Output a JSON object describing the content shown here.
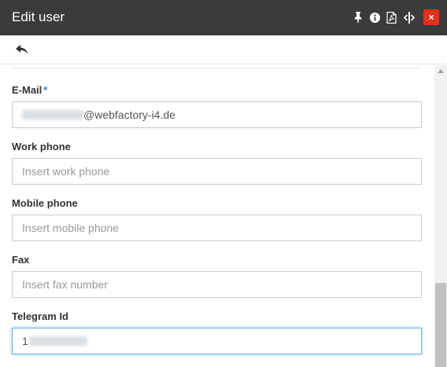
{
  "window": {
    "title": "Edit user",
    "close_label": "×"
  },
  "header_icons": [
    "pin-icon",
    "info-icon",
    "pdf-icon",
    "resize-icon"
  ],
  "toolbar": {
    "back_icon": "reply-arrow-icon"
  },
  "fields": {
    "email": {
      "label": "E-Mail",
      "required_mark": "*",
      "value_suffix": "@webfactory-i4.de"
    },
    "work_phone": {
      "label": "Work phone",
      "placeholder": "Insert work phone"
    },
    "mobile_phone": {
      "label": "Mobile phone",
      "placeholder": "Insert mobile phone"
    },
    "fax": {
      "label": "Fax",
      "placeholder": "Insert fax number"
    },
    "telegram": {
      "label": "Telegram Id",
      "value_prefix": "1"
    }
  },
  "colors": {
    "titlebar": "#3b3b3b",
    "close": "#e0301e",
    "required": "#2c86c9",
    "focus": "#66afe9"
  }
}
